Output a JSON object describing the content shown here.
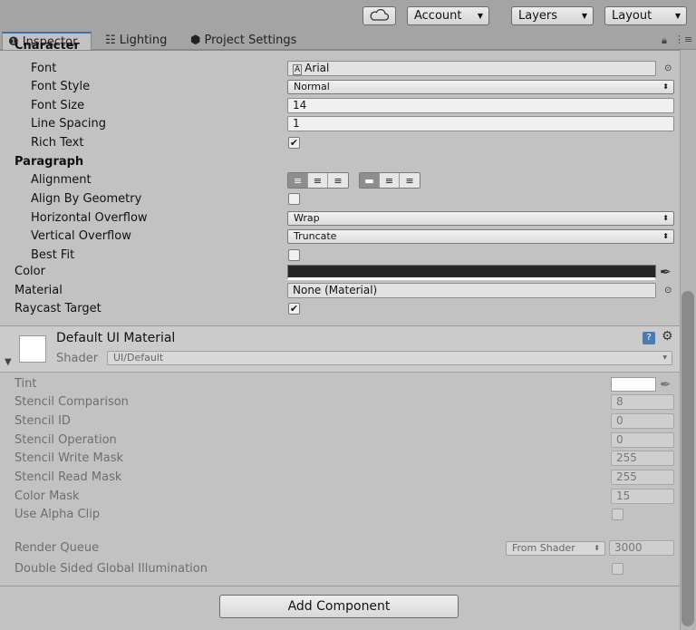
{
  "toolbar": {
    "account": "Account",
    "layers": "Layers",
    "layout": "Layout"
  },
  "tabs": [
    {
      "label": "Inspector",
      "icon": "info-icon",
      "active": true
    },
    {
      "label": "Lighting",
      "icon": "lighting-icon",
      "active": false
    },
    {
      "label": "Project Settings",
      "icon": "gear-icon",
      "active": false
    }
  ],
  "text_component": {
    "section_character": "Character",
    "font_label": "Font",
    "font_value": "Arial",
    "font_style_label": "Font Style",
    "font_style_value": "Normal",
    "font_size_label": "Font Size",
    "font_size_value": "14",
    "line_spacing_label": "Line Spacing",
    "line_spacing_value": "1",
    "rich_text_label": "Rich Text",
    "rich_text_checked": true,
    "section_paragraph": "Paragraph",
    "alignment_label": "Alignment",
    "align_by_geometry_label": "Align By Geometry",
    "align_by_geometry_checked": false,
    "horizontal_overflow_label": "Horizontal Overflow",
    "horizontal_overflow_value": "Wrap",
    "vertical_overflow_label": "Vertical Overflow",
    "vertical_overflow_value": "Truncate",
    "best_fit_label": "Best Fit",
    "best_fit_checked": false,
    "color_label": "Color",
    "color_value": "#262626",
    "material_label": "Material",
    "material_value": "None (Material)",
    "raycast_label": "Raycast Target",
    "raycast_checked": true
  },
  "material": {
    "title": "Default UI Material",
    "shader_label": "Shader",
    "shader_value": "UI/Default",
    "tint_label": "Tint",
    "tint_color": "#ffffff",
    "stencil_comparison_label": "Stencil Comparison",
    "stencil_comparison_value": "8",
    "stencil_id_label": "Stencil ID",
    "stencil_id_value": "0",
    "stencil_operation_label": "Stencil Operation",
    "stencil_operation_value": "0",
    "stencil_write_mask_label": "Stencil Write Mask",
    "stencil_write_mask_value": "255",
    "stencil_read_mask_label": "Stencil Read Mask",
    "stencil_read_mask_value": "255",
    "color_mask_label": "Color Mask",
    "color_mask_value": "15",
    "use_alpha_clip_label": "Use Alpha Clip",
    "render_queue_label": "Render Queue",
    "render_queue_mode": "From Shader",
    "render_queue_value": "3000",
    "double_sided_gi_label": "Double Sided Global Illumination"
  },
  "add_component": "Add Component",
  "colors": {
    "panel": "#c2c2c2",
    "toolbar": "#a4a4a4",
    "accent": "#3a72b0"
  }
}
